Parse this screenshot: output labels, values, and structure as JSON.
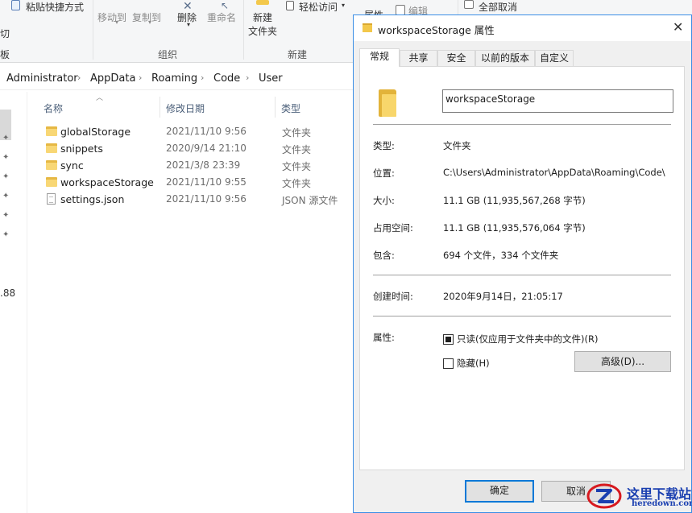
{
  "ribbon": {
    "paste_shortcut": "粘贴快捷方式",
    "move_to": "移动到",
    "copy_to": "复制到",
    "delete": "删除",
    "rename": "重命名",
    "new_folder_line1": "新建",
    "new_folder_line2": "文件夹",
    "easy_access": "轻松访问",
    "properties_partial": "属性",
    "edit": "编辑",
    "select_none": "全部取消",
    "group_organize": "组织",
    "group_new": "新建",
    "left_fragment_1": "切",
    "left_fragment_2": "板"
  },
  "address": {
    "crumbs": [
      "Administrator",
      "AppData",
      "Roaming",
      "Code",
      "User"
    ]
  },
  "leftpane": {
    "fragment": ".88"
  },
  "columns": {
    "name": "名称",
    "modified": "修改日期",
    "type": "类型"
  },
  "files": [
    {
      "name": "globalStorage",
      "date": "2021/11/10 9:56",
      "type": "文件夹",
      "icon": "folder-icon"
    },
    {
      "name": "snippets",
      "date": "2020/9/14 21:10",
      "type": "文件夹",
      "icon": "folder-icon"
    },
    {
      "name": "sync",
      "date": "2021/3/8 23:39",
      "type": "文件夹",
      "icon": "folder-icon"
    },
    {
      "name": "workspaceStorage",
      "date": "2021/11/10 9:55",
      "type": "文件夹",
      "icon": "folder-icon"
    },
    {
      "name": "settings.json",
      "date": "2021/11/10 9:56",
      "type": "JSON 源文件",
      "icon": "json-file-icon"
    }
  ],
  "dialog": {
    "title": "workspaceStorage 属性",
    "tabs": [
      "常规",
      "共享",
      "安全",
      "以前的版本",
      "自定义"
    ],
    "folder_name": "workspaceStorage",
    "type_label": "类型:",
    "type_value": "文件夹",
    "location_label": "位置:",
    "location_value": "C:\\Users\\Administrator\\AppData\\Roaming\\Code\\",
    "size_label": "大小:",
    "size_value": "11.1 GB (11,935,567,268 字节)",
    "disk_label": "占用空间:",
    "disk_value": "11.1 GB (11,935,576,064 字节)",
    "contains_label": "包含:",
    "contains_value": "694 个文件，334 个文件夹",
    "created_label": "创建时间:",
    "created_value": "2020年9月14日，21:05:17",
    "attr_label": "属性:",
    "readonly_label": "只读(仅应用于文件夹中的文件)(R)",
    "readonly_checked": true,
    "hidden_label": "隐藏(H)",
    "hidden_checked": false,
    "advanced_button": "高级(D)...",
    "ok_button": "确定",
    "cancel_button": "取消"
  },
  "watermark": {
    "title": "这里下载站",
    "domain": "heredown.com"
  },
  "colors": {
    "accent": "#0078d7",
    "dialog_border": "#3a8ee6",
    "folder_yellow": "#f8d775",
    "watermark_blue": "#1a3fb0",
    "watermark_red": "#d7191f"
  }
}
